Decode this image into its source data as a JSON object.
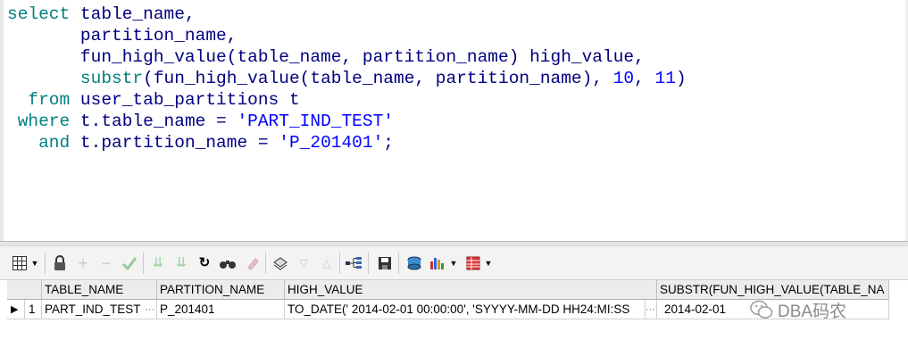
{
  "editor": {
    "line1": {
      "kw": "select",
      "rest": " table_name,"
    },
    "line2": "       partition_name,",
    "line3": "       fun_high_value(table_name, partition_name) high_value,",
    "line4": {
      "indent": "       ",
      "fn": "substr",
      "mid": "(fun_high_value(table_name, partition_name), ",
      "n1": "10",
      "comma": ", ",
      "n2": "11",
      "end": ")"
    },
    "line5": {
      "kw": "  from",
      "rest": " user_tab_partitions t"
    },
    "line6": {
      "kw": " where",
      "rest": " t.table_name = ",
      "str": "'PART_IND_TEST'"
    },
    "line7": {
      "kw": "   and",
      "rest": " t.partition_name = ",
      "str": "'P_201401'",
      "end": ";"
    }
  },
  "toolbar": {
    "icons": [
      "grid-menu-icon",
      "lock-icon",
      "add-icon",
      "remove-icon",
      "post-icon",
      "filter-down-icon",
      "filter-icon",
      "refresh-icon",
      "find-icon",
      "clear-icon",
      "query-by-example-icon",
      "down-icon",
      "up-icon",
      "tree-icon",
      "save-icon",
      "export-icon",
      "chart-icon",
      "grid-view-icon"
    ]
  },
  "grid": {
    "columns": [
      "TABLE_NAME",
      "PARTITION_NAME",
      "HIGH_VALUE",
      "SUBSTR(FUN_HIGH_VALUE(TABLE_NA"
    ],
    "rows": [
      {
        "marker": "▶",
        "num": "1",
        "cells": [
          "PART_IND_TEST",
          "P_201401",
          "TO_DATE(' 2014-02-01 00:00:00', 'SYYYY-MM-DD HH24:MI:SS",
          "2014-02-01"
        ]
      }
    ],
    "ellipsis": "···"
  },
  "watermark": {
    "text": "DBA码农"
  },
  "colors": {
    "keyword": "#007f7f",
    "identifier": "#000080",
    "literal": "#0000ff"
  }
}
